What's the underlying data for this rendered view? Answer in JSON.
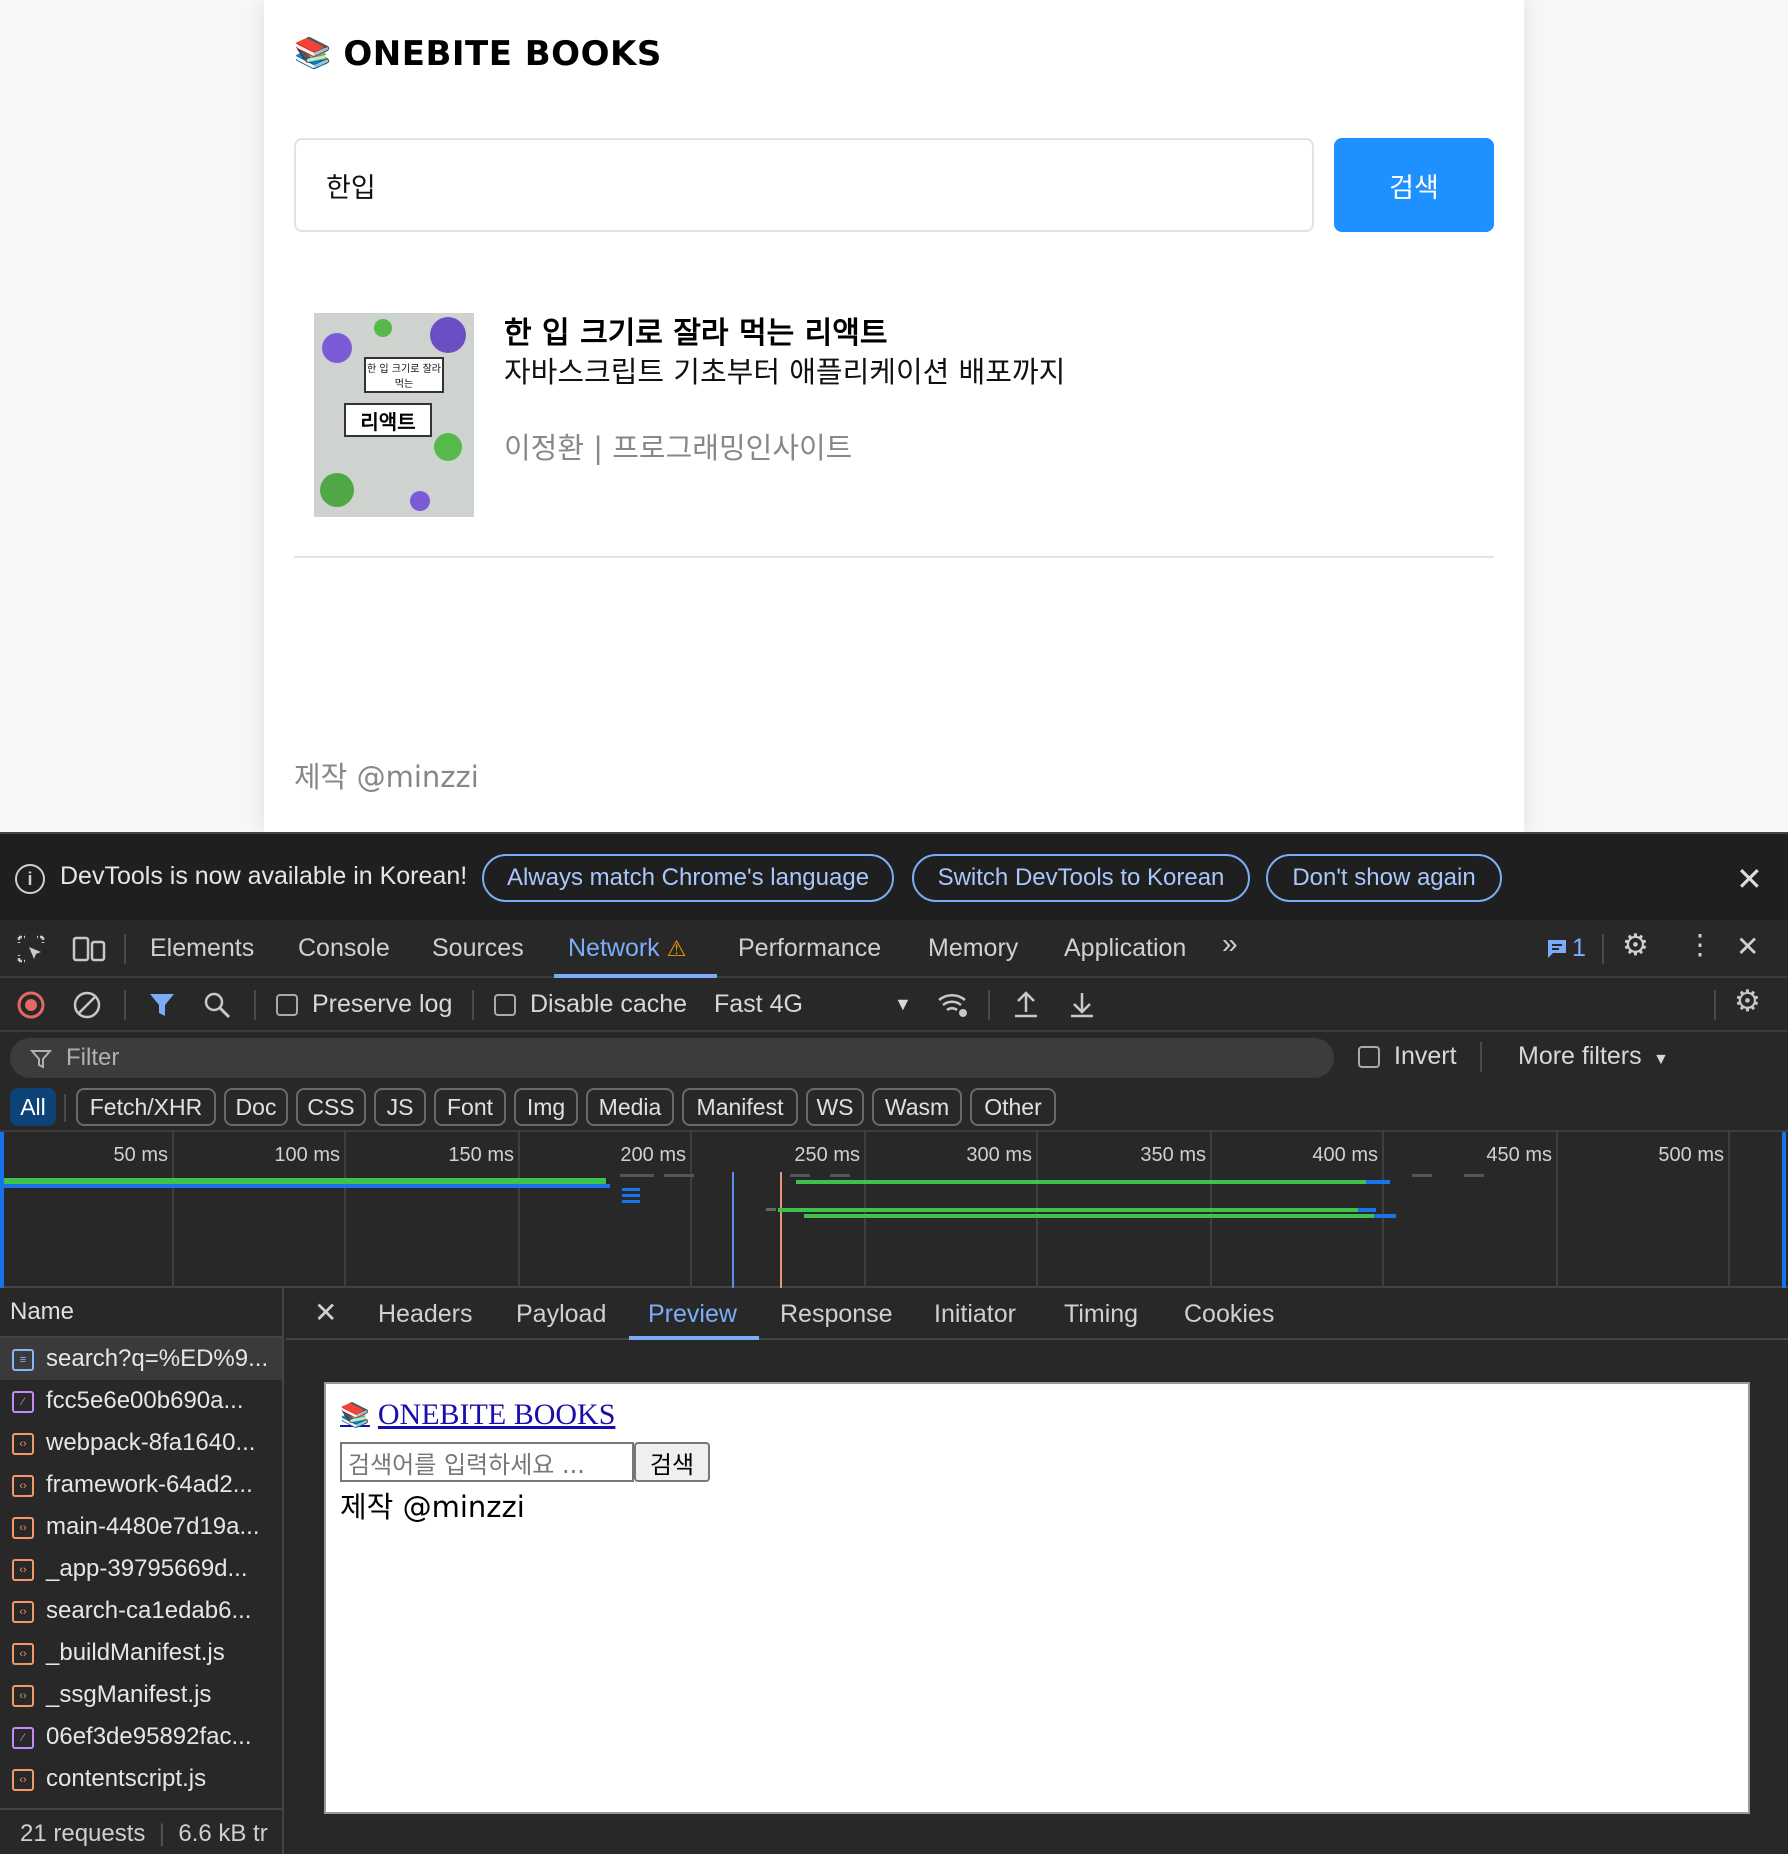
{
  "page": {
    "brand_icon": "books-icon",
    "brand_title": "ONEBITE BOOKS",
    "search_value": "한입",
    "search_button": "검색",
    "result": {
      "title": "한 입 크기로 잘라 먹는 리액트",
      "subtitle": "자바스크립트 기초부터 애플리케이션 배포까지",
      "author_publisher": "이정환 | 프로그래밍인사이트",
      "cover_title": "리액트",
      "cover_subtitle": "한 입 크기로 잘라 먹는"
    },
    "footer": "제작 @minzzi"
  },
  "devtools": {
    "infobar": {
      "message": "DevTools is now available in Korean!",
      "btn_match": "Always match Chrome's language",
      "btn_switch": "Switch DevTools to Korean",
      "btn_dont": "Don't show again"
    },
    "tabs": {
      "elements": "Elements",
      "console": "Console",
      "sources": "Sources",
      "network": "Network",
      "performance": "Performance",
      "memory": "Memory",
      "application": "Application",
      "issues_count": "1"
    },
    "toolbar": {
      "preserve_log": "Preserve log",
      "disable_cache": "Disable cache",
      "throttling": "Fast 4G"
    },
    "filter": {
      "placeholder": "Filter",
      "invert": "Invert",
      "more_filters": "More filters"
    },
    "types": [
      "All",
      "Fetch/XHR",
      "Doc",
      "CSS",
      "JS",
      "Font",
      "Img",
      "Media",
      "Manifest",
      "WS",
      "Wasm",
      "Other"
    ],
    "timeline_ticks": [
      "50 ms",
      "100 ms",
      "150 ms",
      "200 ms",
      "250 ms",
      "300 ms",
      "350 ms",
      "400 ms",
      "450 ms",
      "500 ms"
    ],
    "name_header": "Name",
    "requests": [
      {
        "name": "search?q=%ED%9...",
        "kind": "doc"
      },
      {
        "name": "fcc5e6e00b690a...",
        "kind": "img"
      },
      {
        "name": "webpack-8fa1640...",
        "kind": "js"
      },
      {
        "name": "framework-64ad2...",
        "kind": "js"
      },
      {
        "name": "main-4480e7d19a...",
        "kind": "js"
      },
      {
        "name": "_app-39795669d...",
        "kind": "js"
      },
      {
        "name": "search-ca1edab6...",
        "kind": "js"
      },
      {
        "name": "_buildManifest.js",
        "kind": "js"
      },
      {
        "name": "_ssgManifest.js",
        "kind": "js"
      },
      {
        "name": "06ef3de95892fac...",
        "kind": "img"
      },
      {
        "name": "contentscript.js",
        "kind": "js"
      }
    ],
    "summary": {
      "requests": "21 requests",
      "transferred": "6.6 kB tr"
    },
    "detail_tabs": {
      "headers": "Headers",
      "payload": "Payload",
      "preview": "Preview",
      "response": "Response",
      "initiator": "Initiator",
      "timing": "Timing",
      "cookies": "Cookies"
    },
    "preview": {
      "brand": "ONEBITE BOOKS",
      "input_placeholder": "검색어를 입력하세요 ...",
      "button": "검색",
      "footer": "제작 @minzzi"
    }
  }
}
